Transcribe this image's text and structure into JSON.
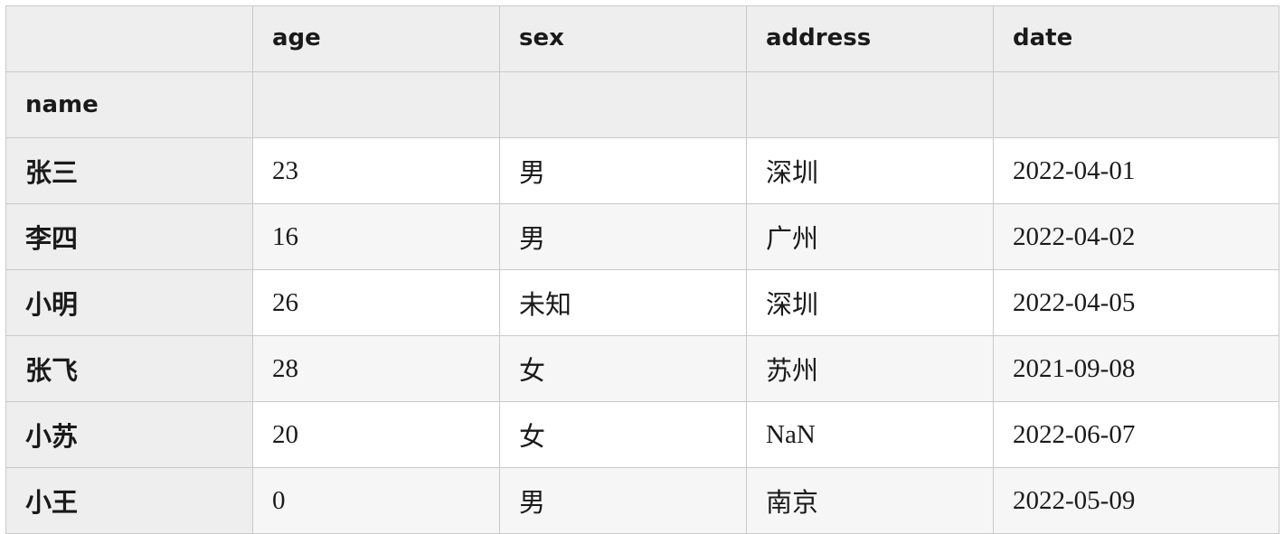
{
  "table": {
    "columns": [
      "age",
      "sex",
      "address",
      "date"
    ],
    "index_name": "name",
    "rows": [
      {
        "name": "张三",
        "age": "23",
        "sex": "男",
        "address": "深圳",
        "date": "2022-04-01"
      },
      {
        "name": "李四",
        "age": "16",
        "sex": "男",
        "address": "广州",
        "date": "2022-04-02"
      },
      {
        "name": "小明",
        "age": "26",
        "sex": "未知",
        "address": "深圳",
        "date": "2022-04-05"
      },
      {
        "name": "张飞",
        "age": "28",
        "sex": "女",
        "address": "苏州",
        "date": "2021-09-08"
      },
      {
        "name": "小苏",
        "age": "20",
        "sex": "女",
        "address": "NaN",
        "date": "2022-06-07"
      },
      {
        "name": "小王",
        "age": "0",
        "sex": "男",
        "address": "南京",
        "date": "2022-05-09"
      }
    ]
  }
}
